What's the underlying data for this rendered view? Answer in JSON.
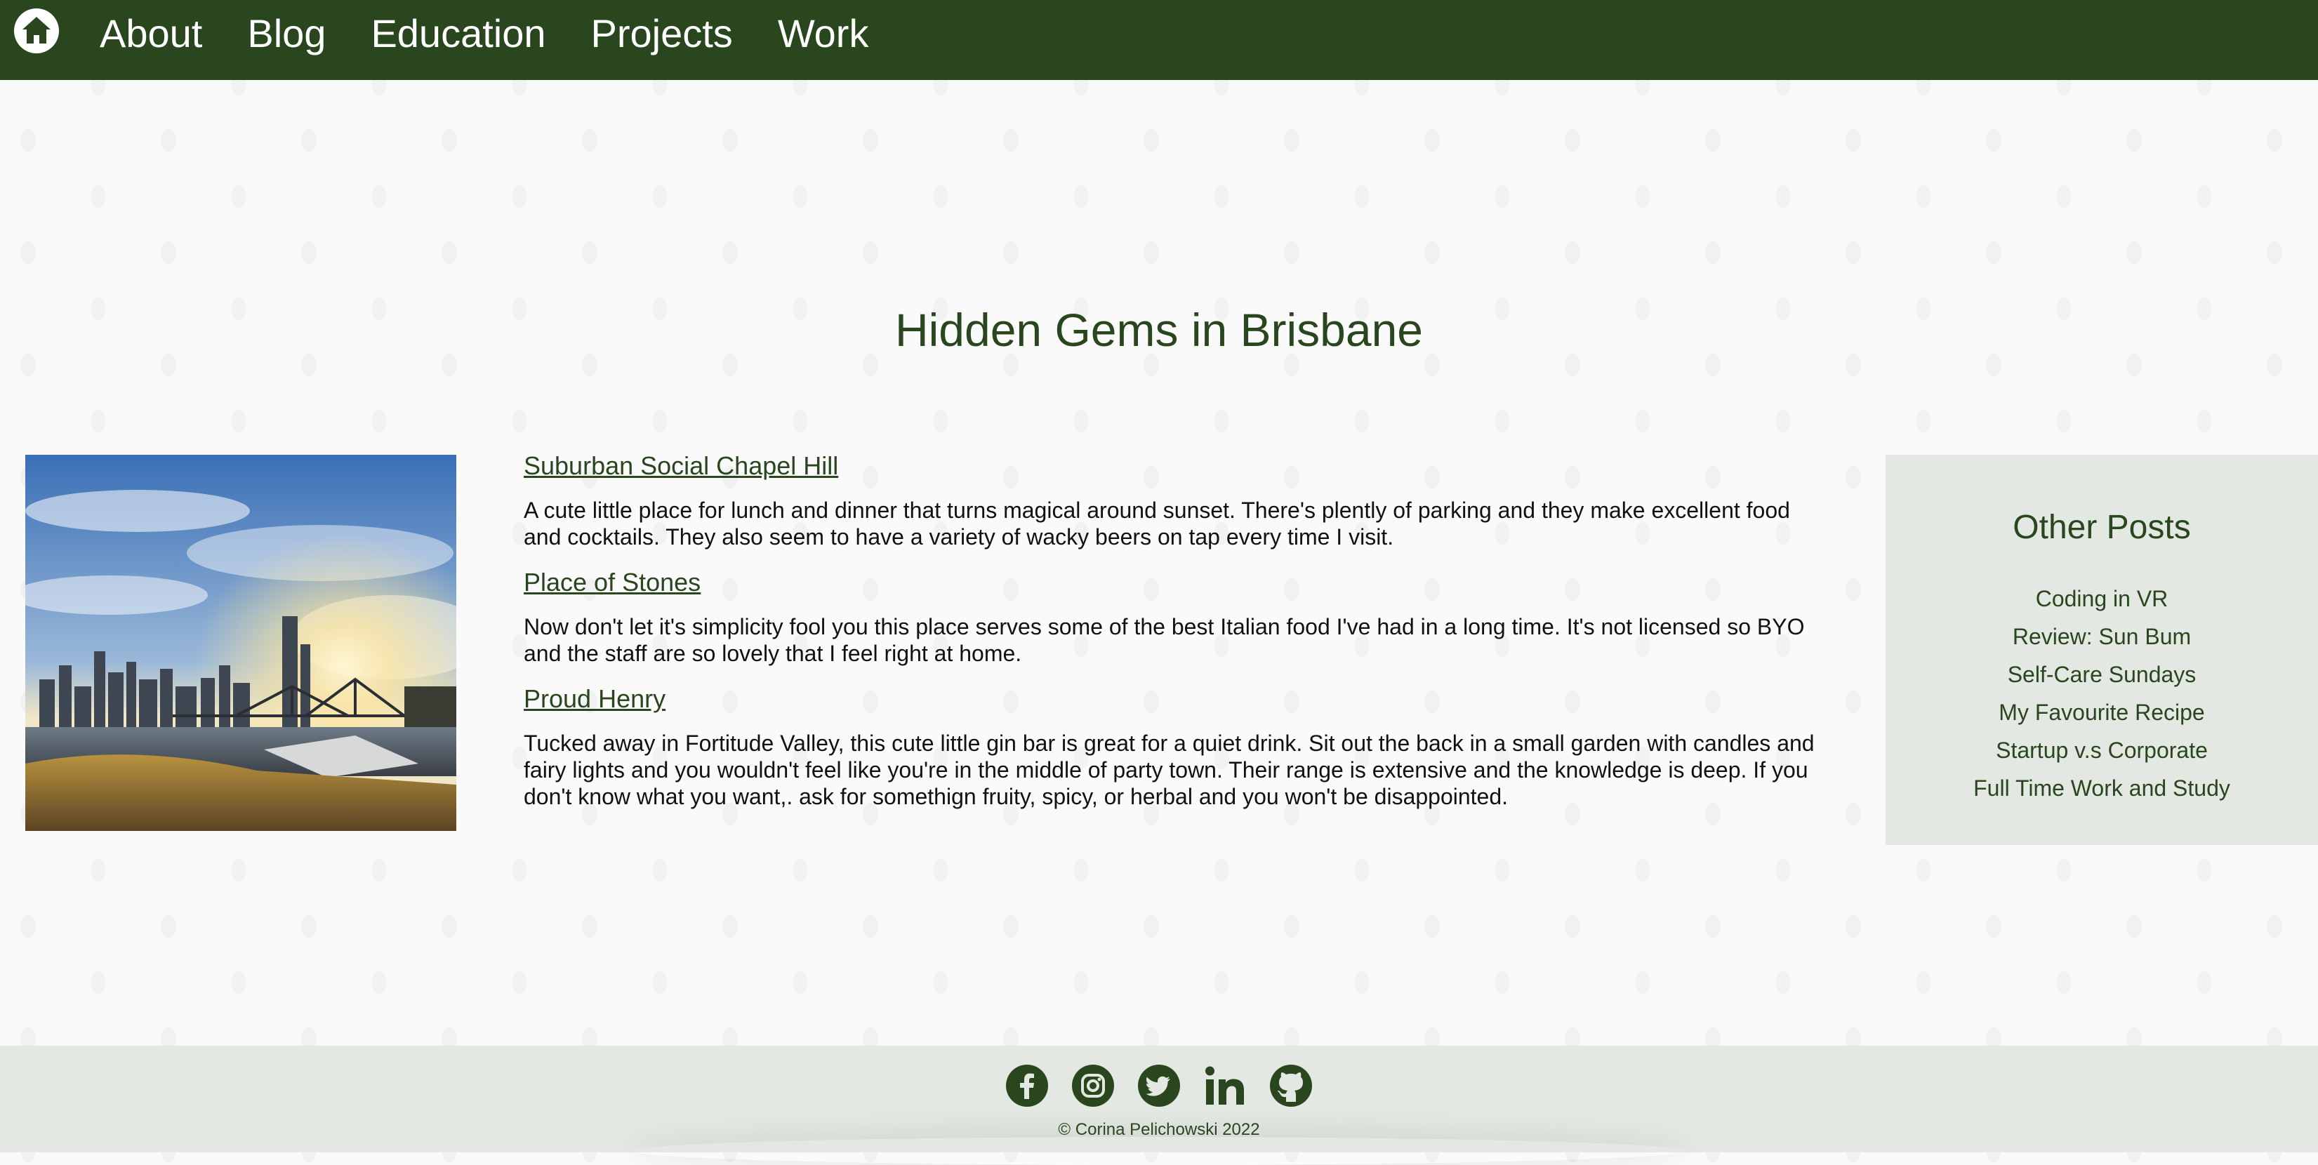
{
  "nav": {
    "home_icon": "home-icon",
    "items": [
      {
        "label": "About"
      },
      {
        "label": "Blog"
      },
      {
        "label": "Education"
      },
      {
        "label": "Projects"
      },
      {
        "label": "Work"
      }
    ]
  },
  "page": {
    "title": "Hidden Gems in Brisbane"
  },
  "hero_image": {
    "description_icon": "brisbane-skyline-photo"
  },
  "entries": [
    {
      "title": "Suburban Social Chapel Hill",
      "body": "A cute little place for lunch and dinner that turns magical around sunset. There's plently of parking and they make excellent food and cocktails. They also seem to have a variety of wacky beers on tap every time I visit."
    },
    {
      "title": "Place of Stones",
      "body": "Now don't let it's simplicity fool you this place serves some of the best Italian food I've had in a long time. It's not licensed so BYO and the staff are so lovely that I feel right at home."
    },
    {
      "title": "Proud Henry",
      "body": "Tucked away in Fortitude Valley, this cute little gin bar is great for a quiet drink. Sit out the back in a small garden with candles and fairy lights and you wouldn't feel like you're in the middle of party town. Their range is extensive and the knowledge is deep. If you don't know what you want,. ask for somethign fruity, spicy, or herbal and you won't be disappointed."
    }
  ],
  "sidebar": {
    "title": "Other Posts",
    "items": [
      {
        "label": "Coding in VR"
      },
      {
        "label": "Review: Sun Bum"
      },
      {
        "label": "Self-Care Sundays"
      },
      {
        "label": "My Favourite Recipe"
      },
      {
        "label": "Startup v.s Corporate"
      },
      {
        "label": "Full Time Work and Study"
      }
    ]
  },
  "footer": {
    "social": [
      {
        "icon": "facebook-icon"
      },
      {
        "icon": "instagram-icon"
      },
      {
        "icon": "twitter-icon"
      },
      {
        "icon": "linkedin-icon"
      },
      {
        "icon": "github-icon"
      }
    ],
    "copyright": "© Corina Pelichowski 2022"
  },
  "colors": {
    "brand_green": "#29461f",
    "panel_bg": "#e4e8e2",
    "page_bg": "#fafafa"
  }
}
